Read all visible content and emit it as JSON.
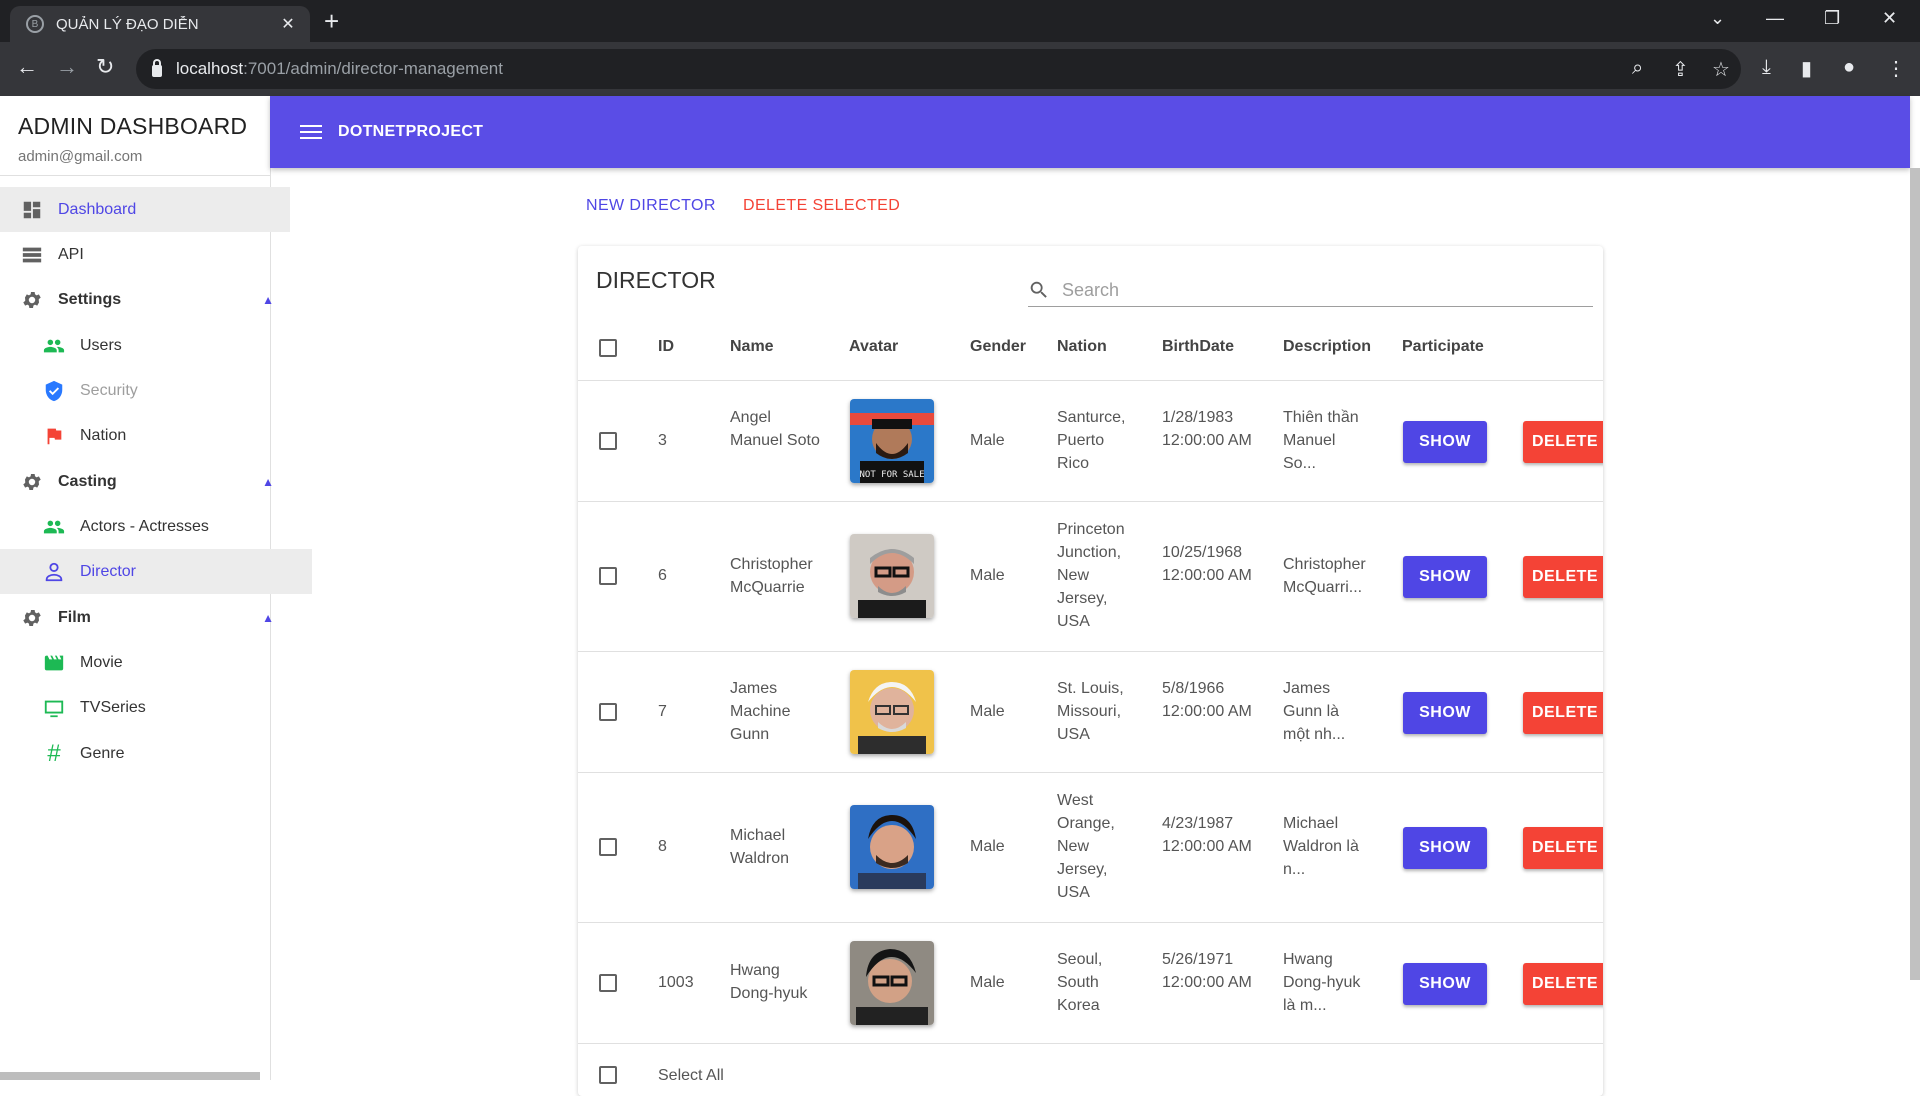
{
  "browser": {
    "tab_title": "QUẢN LÝ ĐẠO DIỄN",
    "url_host": "localhost",
    "url_rest": ":7001/admin/director-management"
  },
  "sidebar": {
    "title": "ADMIN DASHBOARD",
    "email": "admin@gmail.com",
    "items": [
      {
        "label": "Dashboard",
        "icon": "dashboard-icon"
      },
      {
        "label": "API",
        "icon": "api-list-icon"
      },
      {
        "label": "Settings",
        "icon": "gear-icon"
      },
      {
        "label": "Users",
        "icon": "users-icon"
      },
      {
        "label": "Security",
        "icon": "shield-icon"
      },
      {
        "label": "Nation",
        "icon": "flag-icon"
      },
      {
        "label": "Casting",
        "icon": "gear-icon"
      },
      {
        "label": "Actors - Actresses",
        "icon": "users-icon"
      },
      {
        "label": "Director",
        "icon": "person-icon"
      },
      {
        "label": "Film",
        "icon": "gear-icon"
      },
      {
        "label": "Movie",
        "icon": "clapperboard-icon"
      },
      {
        "label": "TVSeries",
        "icon": "tv-icon"
      },
      {
        "label": "Genre",
        "icon": "hashtag-icon"
      }
    ]
  },
  "appbar": {
    "brand": "DOTNETPROJECT"
  },
  "actions": {
    "new": "NEW DIRECTOR",
    "delete_selected": "DELETE SELECTED"
  },
  "table": {
    "title": "DIRECTOR",
    "search_placeholder": "Search",
    "headers": {
      "id": "ID",
      "name": "Name",
      "avatar": "Avatar",
      "gender": "Gender",
      "nation": "Nation",
      "birthdate": "BirthDate",
      "description": "Description",
      "participate": "Participate"
    },
    "rows": [
      {
        "id": "3",
        "name": "Angel Manuel Soto",
        "gender": "Male",
        "nation": "Santurce, Puerto Rico",
        "birthdate": "1/28/1983 12:00:00 AM",
        "description": "Thiên thần Manuel So..."
      },
      {
        "id": "6",
        "name": "Christopher McQuarrie",
        "gender": "Male",
        "nation": "Princeton Junction, New Jersey, USA",
        "birthdate": "10/25/1968 12:00:00 AM",
        "description": "Christopher McQuarri..."
      },
      {
        "id": "7",
        "name": "James Machine Gunn",
        "gender": "Male",
        "nation": "St. Louis, Missouri, USA",
        "birthdate": "5/8/1966 12:00:00 AM",
        "description": "James Gunn là một nh..."
      },
      {
        "id": "8",
        "name": "Michael Waldron",
        "gender": "Male",
        "nation": "West Orange, New Jersey, USA",
        "birthdate": "4/23/1987 12:00:00 AM",
        "description": "Michael Waldron là n..."
      },
      {
        "id": "1003",
        "name": "Hwang Dong-hyuk",
        "gender": "Male",
        "nation": "Seoul, South Korea",
        "birthdate": "5/26/1971 12:00:00 AM",
        "description": "Hwang Dong-hyuk là m..."
      }
    ],
    "show_label": "SHOW",
    "delete_label": "DELETE",
    "select_all": "Select All"
  },
  "colors": {
    "primary": "#4f46e5",
    "appbar": "#5a4de6",
    "danger": "#f44336",
    "green_icon": "#1db954"
  }
}
